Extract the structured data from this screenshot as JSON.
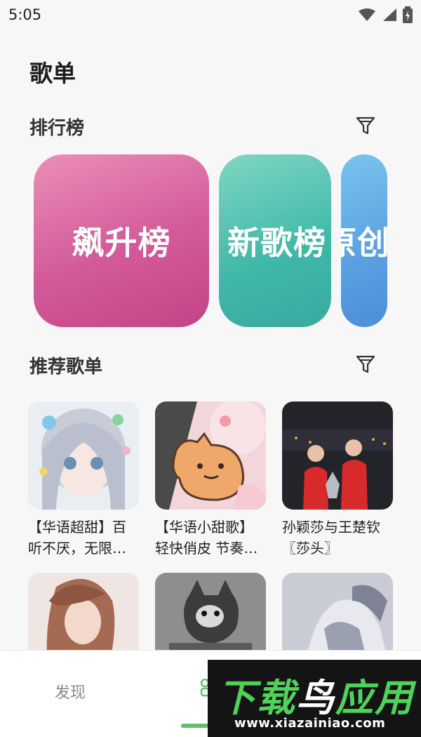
{
  "status_bar": {
    "time": "5:05"
  },
  "page": {
    "title": "歌单"
  },
  "rank_section": {
    "title": "排行榜",
    "cards": [
      {
        "label": "飙升榜"
      },
      {
        "label": "新歌榜"
      },
      {
        "label": "原创"
      }
    ]
  },
  "recommend_section": {
    "title": "推荐歌单",
    "playlists": [
      {
        "title": "【华语超甜】百听不厌，无限循…"
      },
      {
        "title": "【华语小甜歌】轻快俏皮 节奏…"
      },
      {
        "title": "孙颖莎与王楚钦〖莎头〗"
      },
      {
        "title": ""
      },
      {
        "title": ""
      },
      {
        "title": ""
      }
    ]
  },
  "bottom_nav": {
    "discover": "发现"
  },
  "watermark": {
    "brand": "下载鸟应用",
    "url": "www.xiazainiao.com"
  },
  "colors": {
    "accent": "#5fc06c",
    "rank1": "#d35a99",
    "rank2": "#3fb8a8",
    "rank3": "#5aa0e1"
  },
  "icons": [
    "wifi-icon",
    "signal-icon",
    "battery-charging-icon",
    "filter-icon",
    "playlist-nav-icon"
  ]
}
